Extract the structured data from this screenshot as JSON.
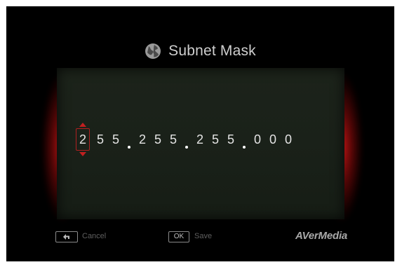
{
  "title": "Subnet Mask",
  "title_icon": "globe-icon",
  "address": {
    "octets": [
      [
        "2",
        "5",
        "5"
      ],
      [
        "2",
        "5",
        "5"
      ],
      [
        "2",
        "5",
        "5"
      ],
      [
        "0",
        "0",
        "0"
      ]
    ],
    "selected_digit": "2"
  },
  "footer": {
    "cancel_key_icon": "back-arrow-icon",
    "cancel_label": "Cancel",
    "ok_key": "OK",
    "save_label": "Save",
    "brand": "AVerMedia"
  },
  "colors": {
    "accent": "#c02020",
    "panel": "#1b2219",
    "background": "#000000"
  }
}
